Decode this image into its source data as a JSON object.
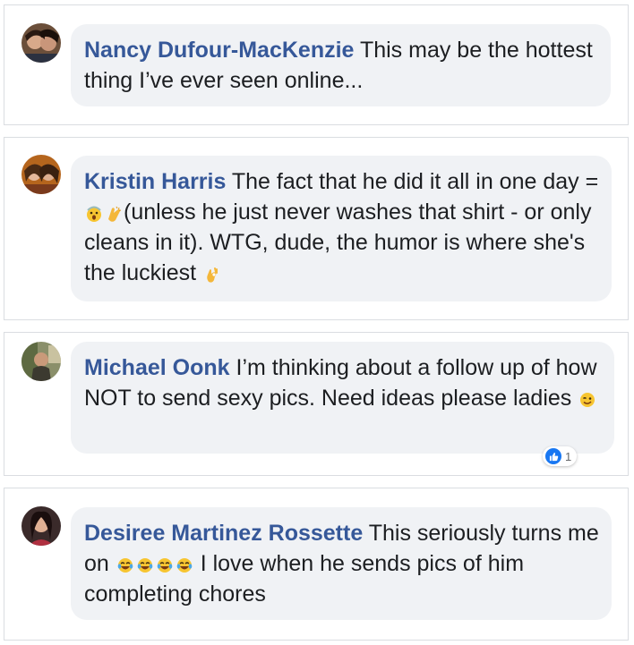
{
  "comments": [
    {
      "author": "Nancy Dufour-MacKenzie",
      "text": " This may be the hottest thing I’ve ever seen online..."
    },
    {
      "author": "Kristin Harris",
      "text_a": " The fact that he did it all in one day = ",
      "text_b": "(unless he just never washes that shirt - or only cleans in it). WTG, dude, the humor is where she's the luckiest ",
      "emojis": [
        "shocked-face-emoji",
        "clapping-hands-emoji",
        "ok-hand-emoji"
      ]
    },
    {
      "author": "Michael Oonk",
      "text": " I’m thinking about a follow up of how NOT to send sexy pics. Need ideas please ladies ",
      "emojis": [
        "winking-face-emoji"
      ],
      "reaction_count": "1",
      "reaction_icon": "like-icon"
    },
    {
      "author": "Desiree Martinez Rossette",
      "text_a": " This seriously turns me on ",
      "text_b": " I love when he sends pics of him completing chores",
      "emojis": [
        "tears-of-joy-emoji",
        "tears-of-joy-emoji",
        "tears-of-joy-emoji",
        "tears-of-joy-emoji"
      ]
    }
  ],
  "colors": {
    "author": "#365899",
    "bubble": "#f0f2f5",
    "text": "#1c1e21",
    "border": "#dadde1",
    "like": "#1877f2"
  }
}
